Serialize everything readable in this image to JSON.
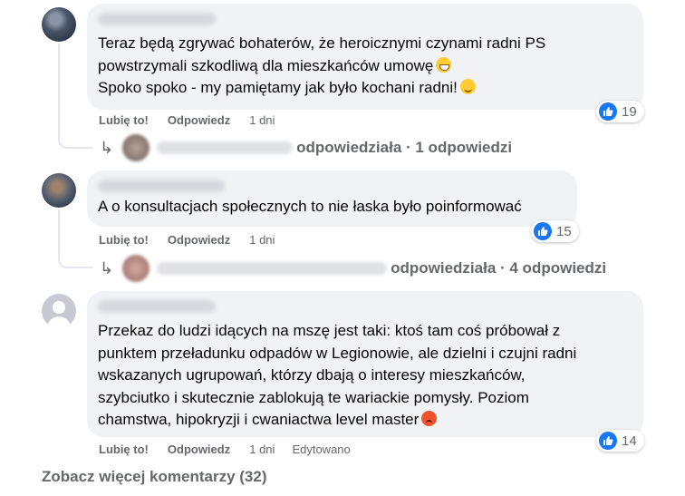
{
  "comments": [
    {
      "text": "Teraz będą zgrywać bohaterów, że heroicznymi czynami radni PS\npowstrzymali szkodliwą dla mieszkańców umowę",
      "text2": "Spoko spoko - my pamiętamy jak było kochani radni!",
      "like_label": "Lubię to!",
      "reply_label": "Odpowiedz",
      "time": "1 dni",
      "reaction_count": "19",
      "replies_text": "odpowiedziała · 1 odpowiedzi"
    },
    {
      "text": "A o konsultacjach społecznych to nie łaska było poinformować",
      "like_label": "Lubię to!",
      "reply_label": "Odpowiedz",
      "time": "1 dni",
      "reaction_count": "15",
      "replies_text": "odpowiedziała · 4 odpowiedzi"
    },
    {
      "text": "Przekaz do ludzi idących na mszę jest taki: ktoś tam coś próbował z\npunktem przeładunku odpadów w Legionowie, ale dzielni i czujni radni\nwskazanych ugrupowań, którzy dbają o interesy mieszkańców,\nszybciutko i skutecznie zablokują te wariackie pomysły. Poziom\nchamstwa, hipokryzji i cwaniactwa level master",
      "like_label": "Lubię to!",
      "reply_label": "Odpowiedz",
      "time": "1 dni",
      "edited": "Edytowano",
      "reaction_count": "14"
    }
  ],
  "see_more": "Zobacz więcej komentarzy (32)",
  "icons": [
    "like-icon",
    "reply-arrow-icon",
    "grinning-emoji-icon",
    "wink-emoji-icon",
    "angry-emoji-icon",
    "default-avatar-icon"
  ],
  "colors": {
    "bubble": "#f0f2f5",
    "like_blue": "#1877f2",
    "secondary_text": "#65676b"
  }
}
